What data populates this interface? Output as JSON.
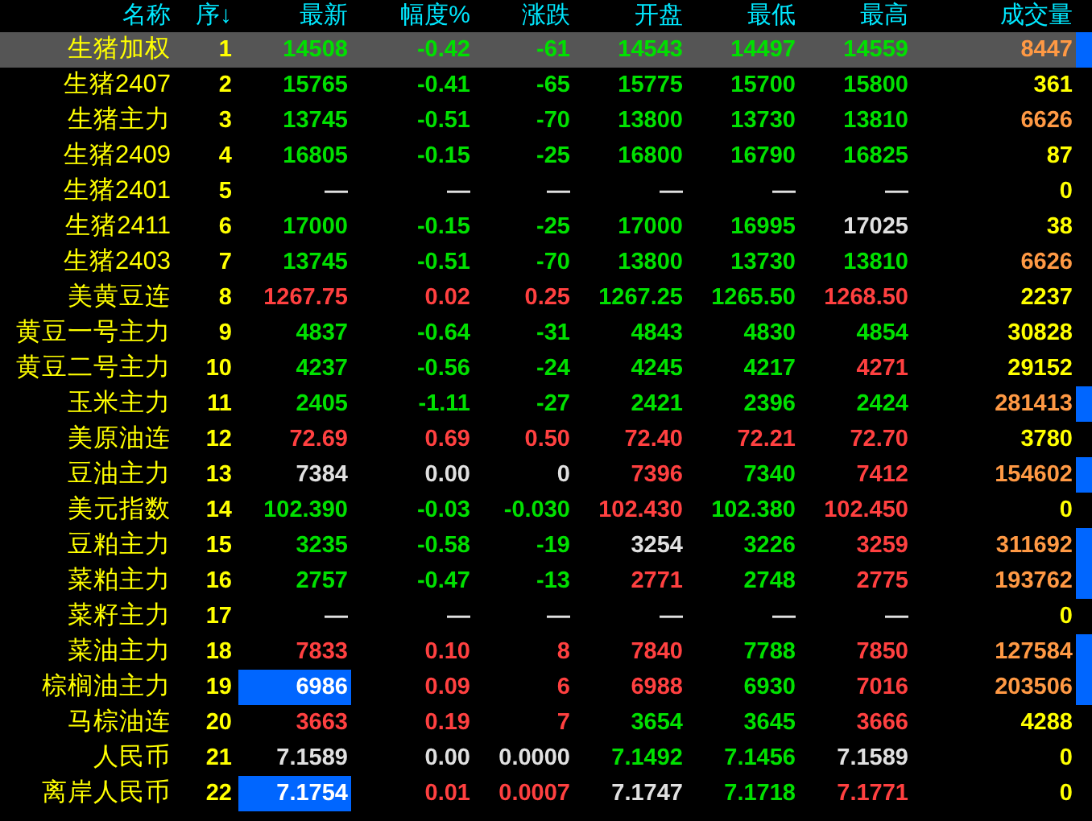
{
  "columns": [
    "名称",
    "序↓",
    "最新",
    "幅度%",
    "涨跌",
    "开盘",
    "最低",
    "最高",
    "成交量"
  ],
  "rows": [
    {
      "name": "生猪加权",
      "seq": "1",
      "selected": true,
      "latest_flash": false,
      "volume_marker": true,
      "cells": [
        {
          "text": "14508",
          "color": "#00e000"
        },
        {
          "text": "-0.42",
          "color": "#00e000"
        },
        {
          "text": "-61",
          "color": "#00e000"
        },
        {
          "text": "14543",
          "color": "#00e000"
        },
        {
          "text": "14497",
          "color": "#00e000"
        },
        {
          "text": "14559",
          "color": "#00e000"
        },
        {
          "text": "8447",
          "color": "#ff9944"
        }
      ]
    },
    {
      "name": "生猪2407",
      "seq": "2",
      "selected": false,
      "latest_flash": false,
      "volume_marker": false,
      "cells": [
        {
          "text": "15765",
          "color": "#00e000"
        },
        {
          "text": "-0.41",
          "color": "#00e000"
        },
        {
          "text": "-65",
          "color": "#00e000"
        },
        {
          "text": "15775",
          "color": "#00e000"
        },
        {
          "text": "15700",
          "color": "#00e000"
        },
        {
          "text": "15800",
          "color": "#00e000"
        },
        {
          "text": "361",
          "color": "#ffff00"
        }
      ]
    },
    {
      "name": "生猪主力",
      "seq": "3",
      "selected": false,
      "latest_flash": false,
      "volume_marker": false,
      "cells": [
        {
          "text": "13745",
          "color": "#00e000"
        },
        {
          "text": "-0.51",
          "color": "#00e000"
        },
        {
          "text": "-70",
          "color": "#00e000"
        },
        {
          "text": "13800",
          "color": "#00e000"
        },
        {
          "text": "13730",
          "color": "#00e000"
        },
        {
          "text": "13810",
          "color": "#00e000"
        },
        {
          "text": "6626",
          "color": "#ff9944"
        }
      ]
    },
    {
      "name": "生猪2409",
      "seq": "4",
      "selected": false,
      "latest_flash": false,
      "volume_marker": false,
      "cells": [
        {
          "text": "16805",
          "color": "#00e000"
        },
        {
          "text": "-0.15",
          "color": "#00e000"
        },
        {
          "text": "-25",
          "color": "#00e000"
        },
        {
          "text": "16800",
          "color": "#00e000"
        },
        {
          "text": "16790",
          "color": "#00e000"
        },
        {
          "text": "16825",
          "color": "#00e000"
        },
        {
          "text": "87",
          "color": "#ffff00"
        }
      ]
    },
    {
      "name": "生猪2401",
      "seq": "5",
      "selected": false,
      "latest_flash": false,
      "volume_marker": false,
      "cells": [
        {
          "text": "—",
          "color": "#e0e0e0"
        },
        {
          "text": "—",
          "color": "#e0e0e0"
        },
        {
          "text": "—",
          "color": "#e0e0e0"
        },
        {
          "text": "—",
          "color": "#e0e0e0"
        },
        {
          "text": "—",
          "color": "#e0e0e0"
        },
        {
          "text": "—",
          "color": "#e0e0e0"
        },
        {
          "text": "0",
          "color": "#ffff00"
        }
      ]
    },
    {
      "name": "生猪2411",
      "seq": "6",
      "selected": false,
      "latest_flash": false,
      "volume_marker": false,
      "cells": [
        {
          "text": "17000",
          "color": "#00e000"
        },
        {
          "text": "-0.15",
          "color": "#00e000"
        },
        {
          "text": "-25",
          "color": "#00e000"
        },
        {
          "text": "17000",
          "color": "#00e000"
        },
        {
          "text": "16995",
          "color": "#00e000"
        },
        {
          "text": "17025",
          "color": "#e0e0e0"
        },
        {
          "text": "38",
          "color": "#ffff00"
        }
      ]
    },
    {
      "name": "生猪2403",
      "seq": "7",
      "selected": false,
      "latest_flash": false,
      "volume_marker": false,
      "cells": [
        {
          "text": "13745",
          "color": "#00e000"
        },
        {
          "text": "-0.51",
          "color": "#00e000"
        },
        {
          "text": "-70",
          "color": "#00e000"
        },
        {
          "text": "13800",
          "color": "#00e000"
        },
        {
          "text": "13730",
          "color": "#00e000"
        },
        {
          "text": "13810",
          "color": "#00e000"
        },
        {
          "text": "6626",
          "color": "#ff9944"
        }
      ]
    },
    {
      "name": "美黄豆连",
      "seq": "8",
      "selected": false,
      "latest_flash": false,
      "volume_marker": false,
      "cells": [
        {
          "text": "1267.75",
          "color": "#ff4040"
        },
        {
          "text": "0.02",
          "color": "#ff4040"
        },
        {
          "text": "0.25",
          "color": "#ff4040"
        },
        {
          "text": "1267.25",
          "color": "#00e000"
        },
        {
          "text": "1265.50",
          "color": "#00e000"
        },
        {
          "text": "1268.50",
          "color": "#ff4040"
        },
        {
          "text": "2237",
          "color": "#ffff00"
        }
      ]
    },
    {
      "name": "黄豆一号主力",
      "seq": "9",
      "selected": false,
      "latest_flash": false,
      "volume_marker": false,
      "cells": [
        {
          "text": "4837",
          "color": "#00e000"
        },
        {
          "text": "-0.64",
          "color": "#00e000"
        },
        {
          "text": "-31",
          "color": "#00e000"
        },
        {
          "text": "4843",
          "color": "#00e000"
        },
        {
          "text": "4830",
          "color": "#00e000"
        },
        {
          "text": "4854",
          "color": "#00e000"
        },
        {
          "text": "30828",
          "color": "#ffff00"
        }
      ]
    },
    {
      "name": "黄豆二号主力",
      "seq": "10",
      "selected": false,
      "latest_flash": false,
      "volume_marker": false,
      "cells": [
        {
          "text": "4237",
          "color": "#00e000"
        },
        {
          "text": "-0.56",
          "color": "#00e000"
        },
        {
          "text": "-24",
          "color": "#00e000"
        },
        {
          "text": "4245",
          "color": "#00e000"
        },
        {
          "text": "4217",
          "color": "#00e000"
        },
        {
          "text": "4271",
          "color": "#ff4040"
        },
        {
          "text": "29152",
          "color": "#ffff00"
        }
      ]
    },
    {
      "name": "玉米主力",
      "seq": "11",
      "selected": false,
      "latest_flash": false,
      "volume_marker": true,
      "cells": [
        {
          "text": "2405",
          "color": "#00e000"
        },
        {
          "text": "-1.11",
          "color": "#00e000"
        },
        {
          "text": "-27",
          "color": "#00e000"
        },
        {
          "text": "2421",
          "color": "#00e000"
        },
        {
          "text": "2396",
          "color": "#00e000"
        },
        {
          "text": "2424",
          "color": "#00e000"
        },
        {
          "text": "281413",
          "color": "#ff9944"
        }
      ]
    },
    {
      "name": "美原油连",
      "seq": "12",
      "selected": false,
      "latest_flash": false,
      "volume_marker": false,
      "cells": [
        {
          "text": "72.69",
          "color": "#ff4040"
        },
        {
          "text": "0.69",
          "color": "#ff4040"
        },
        {
          "text": "0.50",
          "color": "#ff4040"
        },
        {
          "text": "72.40",
          "color": "#ff4040"
        },
        {
          "text": "72.21",
          "color": "#ff4040"
        },
        {
          "text": "72.70",
          "color": "#ff4040"
        },
        {
          "text": "3780",
          "color": "#ffff00"
        }
      ]
    },
    {
      "name": "豆油主力",
      "seq": "13",
      "selected": false,
      "latest_flash": false,
      "volume_marker": true,
      "cells": [
        {
          "text": "7384",
          "color": "#e0e0e0"
        },
        {
          "text": "0.00",
          "color": "#e0e0e0"
        },
        {
          "text": "0",
          "color": "#e0e0e0"
        },
        {
          "text": "7396",
          "color": "#ff4040"
        },
        {
          "text": "7340",
          "color": "#00e000"
        },
        {
          "text": "7412",
          "color": "#ff4040"
        },
        {
          "text": "154602",
          "color": "#ff9944"
        }
      ]
    },
    {
      "name": "美元指数",
      "seq": "14",
      "selected": false,
      "latest_flash": false,
      "volume_marker": false,
      "cells": [
        {
          "text": "102.390",
          "color": "#00e000"
        },
        {
          "text": "-0.03",
          "color": "#00e000"
        },
        {
          "text": "-0.030",
          "color": "#00e000"
        },
        {
          "text": "102.430",
          "color": "#ff4040"
        },
        {
          "text": "102.380",
          "color": "#00e000"
        },
        {
          "text": "102.450",
          "color": "#ff4040"
        },
        {
          "text": "0",
          "color": "#ffff00"
        }
      ]
    },
    {
      "name": "豆粕主力",
      "seq": "15",
      "selected": false,
      "latest_flash": false,
      "volume_marker": true,
      "cells": [
        {
          "text": "3235",
          "color": "#00e000"
        },
        {
          "text": "-0.58",
          "color": "#00e000"
        },
        {
          "text": "-19",
          "color": "#00e000"
        },
        {
          "text": "3254",
          "color": "#e0e0e0"
        },
        {
          "text": "3226",
          "color": "#00e000"
        },
        {
          "text": "3259",
          "color": "#ff4040"
        },
        {
          "text": "311692",
          "color": "#ff9944"
        }
      ]
    },
    {
      "name": "菜粕主力",
      "seq": "16",
      "selected": false,
      "latest_flash": false,
      "volume_marker": true,
      "cells": [
        {
          "text": "2757",
          "color": "#00e000"
        },
        {
          "text": "-0.47",
          "color": "#00e000"
        },
        {
          "text": "-13",
          "color": "#00e000"
        },
        {
          "text": "2771",
          "color": "#ff4040"
        },
        {
          "text": "2748",
          "color": "#00e000"
        },
        {
          "text": "2775",
          "color": "#ff4040"
        },
        {
          "text": "193762",
          "color": "#ff9944"
        }
      ]
    },
    {
      "name": "菜籽主力",
      "seq": "17",
      "selected": false,
      "latest_flash": false,
      "volume_marker": false,
      "cells": [
        {
          "text": "—",
          "color": "#e0e0e0"
        },
        {
          "text": "—",
          "color": "#e0e0e0"
        },
        {
          "text": "—",
          "color": "#e0e0e0"
        },
        {
          "text": "—",
          "color": "#e0e0e0"
        },
        {
          "text": "—",
          "color": "#e0e0e0"
        },
        {
          "text": "—",
          "color": "#e0e0e0"
        },
        {
          "text": "0",
          "color": "#ffff00"
        }
      ]
    },
    {
      "name": "菜油主力",
      "seq": "18",
      "selected": false,
      "latest_flash": false,
      "volume_marker": true,
      "cells": [
        {
          "text": "7833",
          "color": "#ff4040"
        },
        {
          "text": "0.10",
          "color": "#ff4040"
        },
        {
          "text": "8",
          "color": "#ff4040"
        },
        {
          "text": "7840",
          "color": "#ff4040"
        },
        {
          "text": "7788",
          "color": "#00e000"
        },
        {
          "text": "7850",
          "color": "#ff4040"
        },
        {
          "text": "127584",
          "color": "#ff9944"
        }
      ]
    },
    {
      "name": "棕榈油主力",
      "seq": "19",
      "selected": false,
      "latest_flash": true,
      "volume_marker": true,
      "cells": [
        {
          "text": "6986",
          "color": "#ffffff"
        },
        {
          "text": "0.09",
          "color": "#ff4040"
        },
        {
          "text": "6",
          "color": "#ff4040"
        },
        {
          "text": "6988",
          "color": "#ff4040"
        },
        {
          "text": "6930",
          "color": "#00e000"
        },
        {
          "text": "7016",
          "color": "#ff4040"
        },
        {
          "text": "203506",
          "color": "#ff9944"
        }
      ]
    },
    {
      "name": "马棕油连",
      "seq": "20",
      "selected": false,
      "latest_flash": false,
      "volume_marker": false,
      "cells": [
        {
          "text": "3663",
          "color": "#ff4040"
        },
        {
          "text": "0.19",
          "color": "#ff4040"
        },
        {
          "text": "7",
          "color": "#ff4040"
        },
        {
          "text": "3654",
          "color": "#00e000"
        },
        {
          "text": "3645",
          "color": "#00e000"
        },
        {
          "text": "3666",
          "color": "#ff4040"
        },
        {
          "text": "4288",
          "color": "#ffff00"
        }
      ]
    },
    {
      "name": "人民币",
      "seq": "21",
      "selected": false,
      "latest_flash": false,
      "volume_marker": false,
      "cells": [
        {
          "text": "7.1589",
          "color": "#e0e0e0"
        },
        {
          "text": "0.00",
          "color": "#e0e0e0"
        },
        {
          "text": "0.0000",
          "color": "#e0e0e0"
        },
        {
          "text": "7.1492",
          "color": "#00e000"
        },
        {
          "text": "7.1456",
          "color": "#00e000"
        },
        {
          "text": "7.1589",
          "color": "#e0e0e0"
        },
        {
          "text": "0",
          "color": "#ffff00"
        }
      ]
    },
    {
      "name": "离岸人民币",
      "seq": "22",
      "selected": false,
      "latest_flash": true,
      "volume_marker": false,
      "cells": [
        {
          "text": "7.1754",
          "color": "#ffffff"
        },
        {
          "text": "0.01",
          "color": "#ff4040"
        },
        {
          "text": "0.0007",
          "color": "#ff4040"
        },
        {
          "text": "7.1747",
          "color": "#e0e0e0"
        },
        {
          "text": "7.1718",
          "color": "#00e000"
        },
        {
          "text": "7.1771",
          "color": "#ff4040"
        },
        {
          "text": "0",
          "color": "#ffff00"
        }
      ]
    }
  ]
}
